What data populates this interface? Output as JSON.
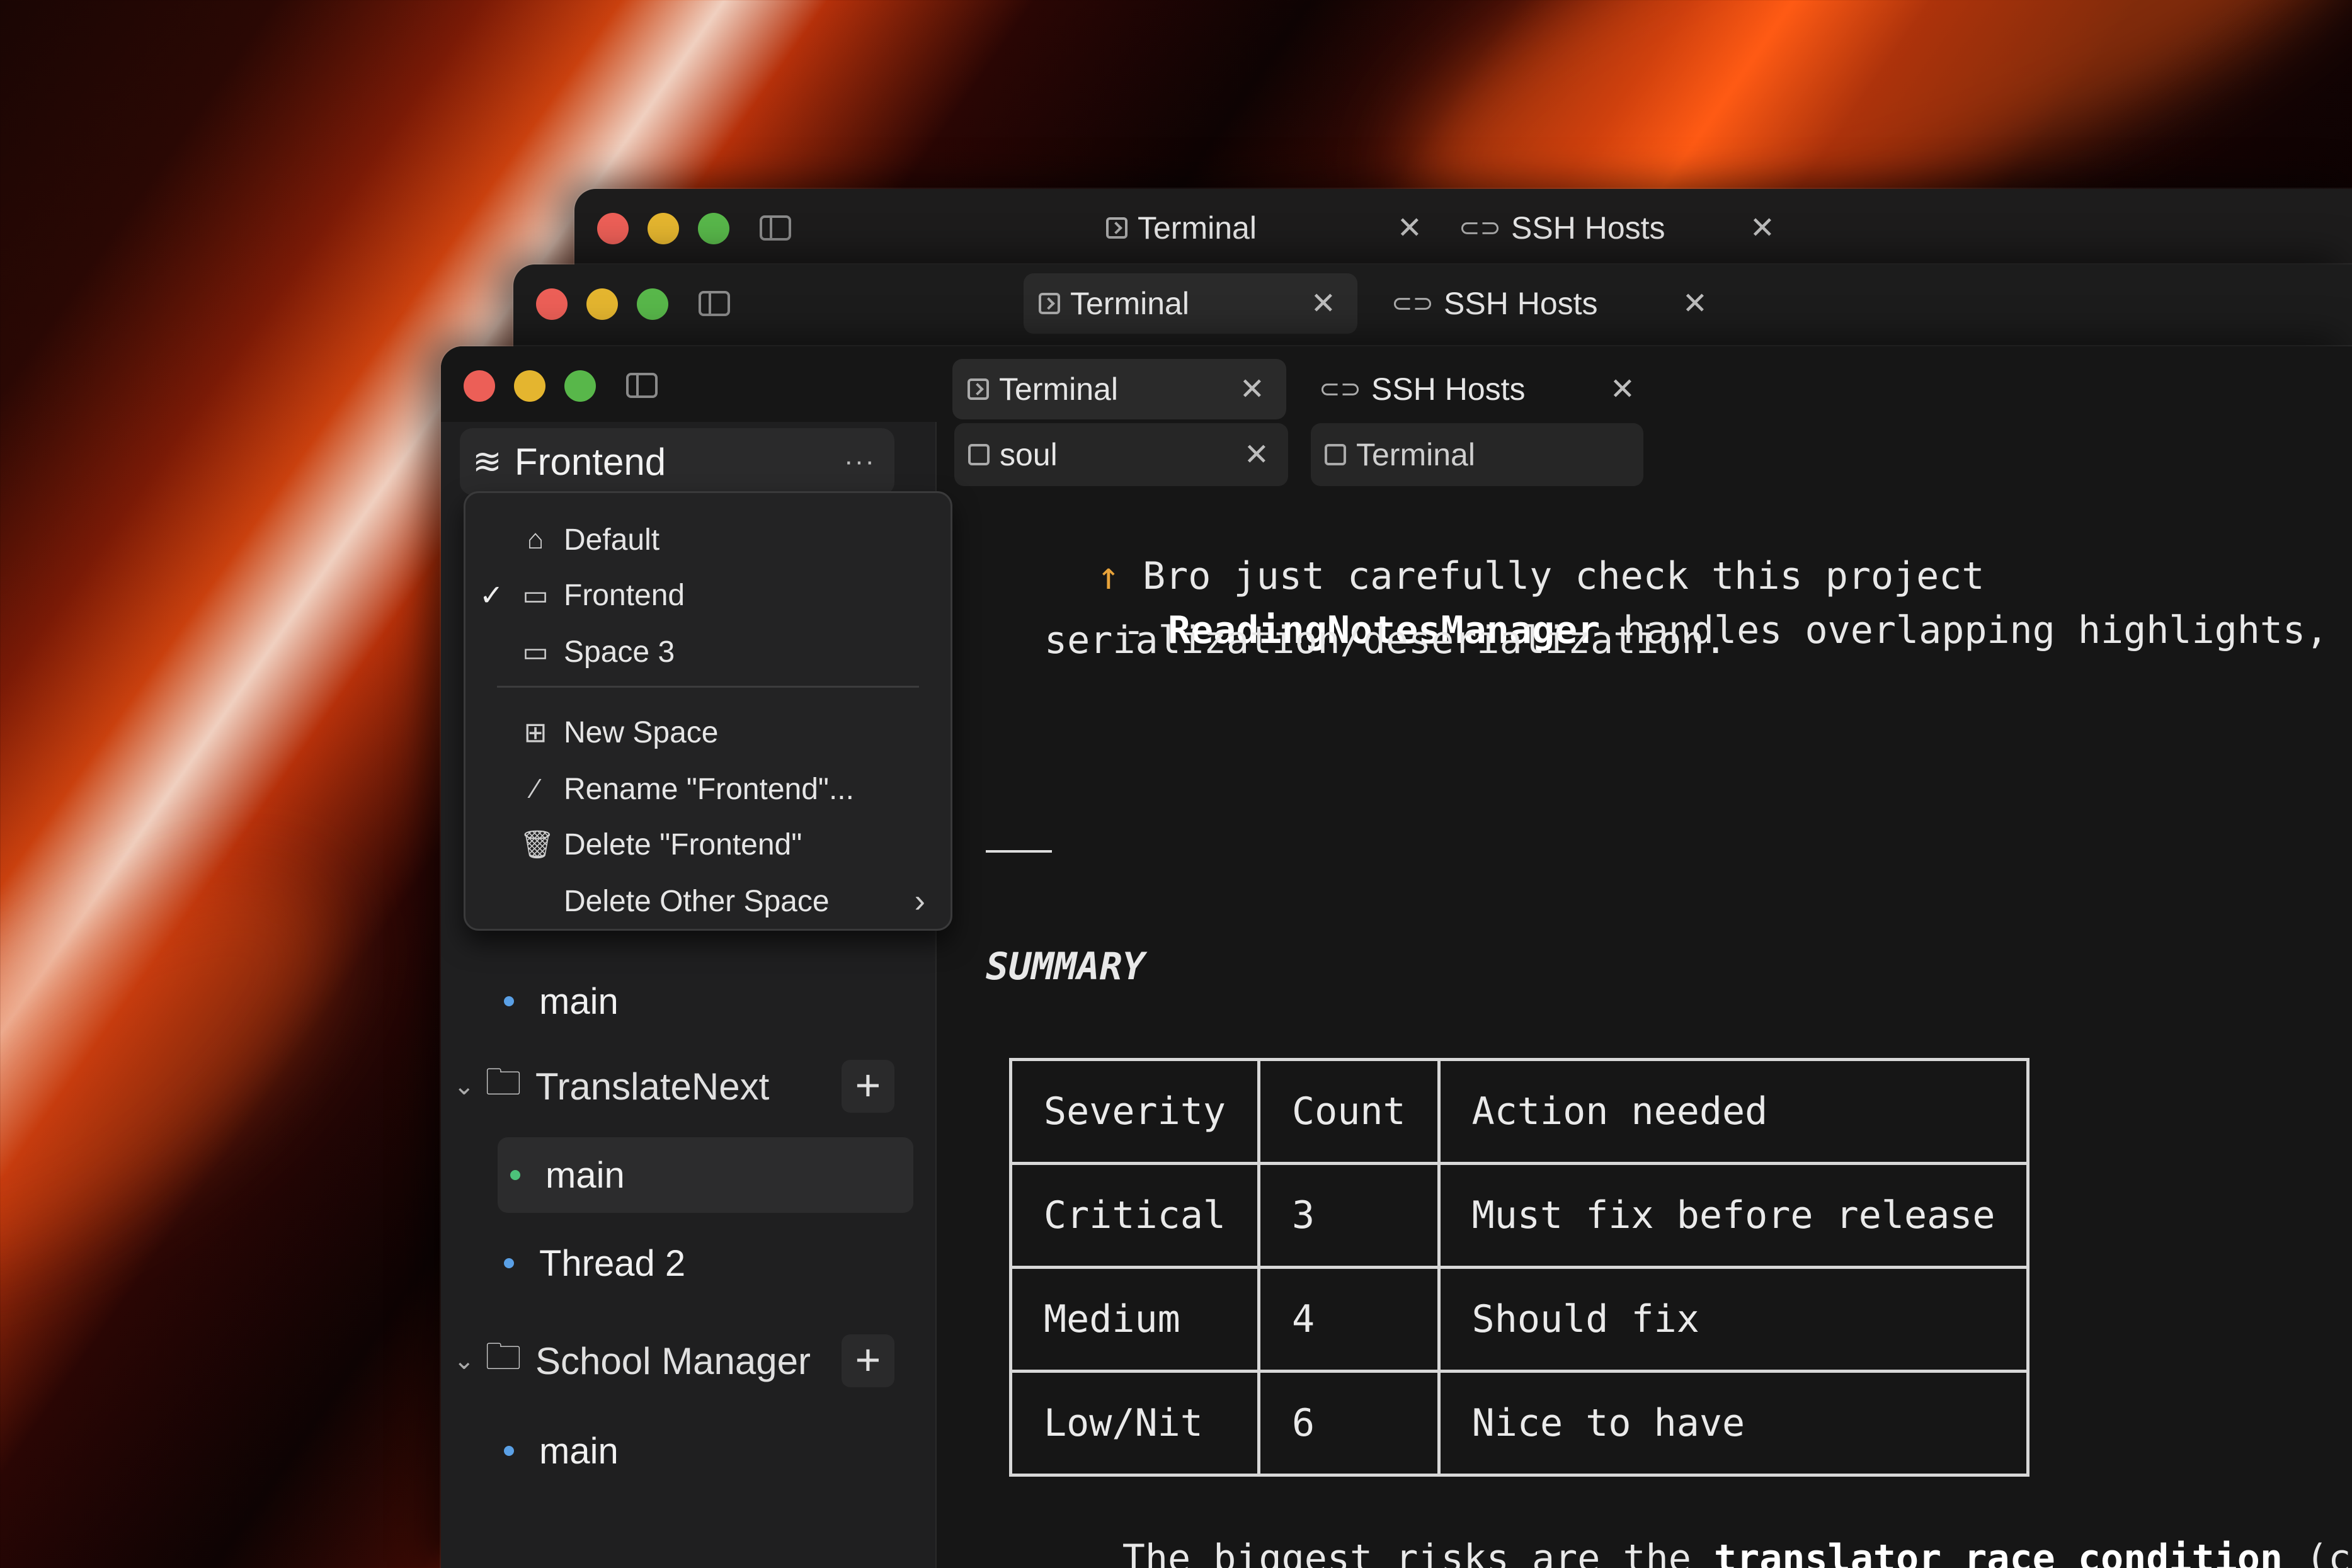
{
  "windows": {
    "back": {
      "tabs": [
        {
          "label": "Terminal",
          "icon": "terminal-icon"
        },
        {
          "label": "SSH Hosts",
          "icon": "link-icon"
        }
      ]
    },
    "middle": {
      "tabs": [
        {
          "label": "Terminal",
          "icon": "terminal-icon"
        },
        {
          "label": "SSH Hosts",
          "icon": "link-icon"
        }
      ]
    },
    "front": {
      "tabs": [
        {
          "label": "Terminal",
          "icon": "terminal-icon"
        },
        {
          "label": "SSH Hosts",
          "icon": "link-icon"
        }
      ],
      "subtabs": [
        {
          "label": "soul",
          "icon": "terminal-icon"
        },
        {
          "label": "Terminal",
          "icon": "terminal-icon"
        }
      ]
    }
  },
  "sidebar": {
    "space_title": "Frontend",
    "more": "···",
    "space_menu": {
      "items": [
        {
          "label": "Default",
          "icon": "home-icon",
          "checked": false
        },
        {
          "label": "Frontend",
          "icon": "space-icon",
          "checked": true
        },
        {
          "label": "Space 3",
          "icon": "space-icon",
          "checked": false
        }
      ],
      "actions": [
        {
          "label": "New Space",
          "icon": "plus-square-icon"
        },
        {
          "label": "Rename \"Frontend\"...",
          "icon": "pencil-icon"
        },
        {
          "label": "Delete \"Frontend\"",
          "icon": "trash-icon"
        },
        {
          "label": "Delete Other Space",
          "icon": "",
          "submenu": true
        }
      ]
    },
    "threads_top": [
      {
        "label": "main"
      }
    ],
    "folders": [
      {
        "name": "TranslateNext",
        "threads": [
          {
            "label": "main",
            "selected": true
          },
          {
            "label": "Thread 2",
            "selected": false
          }
        ]
      },
      {
        "name": "School Manager",
        "threads": [
          {
            "label": "main",
            "selected": false
          }
        ]
      }
    ]
  },
  "terminal": {
    "prompt_arrow": "↑",
    "prompt_text": "Bro just carefully check this project",
    "bullet_dash": "-",
    "bullet_bold": "ReadingNotesManager",
    "bullet_rest": " handles overlapping highlights, translat",
    "bullet_line2": "serialization/deserialization.",
    "heading": "SUMMARY",
    "table": {
      "headers": [
        "Severity",
        "Count",
        "Action needed"
      ],
      "rows": [
        [
          "Critical",
          "3",
          "Must fix before release"
        ],
        [
          "Medium",
          "4",
          "Should fix"
        ],
        [
          "Low/Nit",
          "6",
          "Nice to have"
        ]
      ]
    },
    "footer_prefix": "The biggest risks are the ",
    "footer_bold": "translator race condition",
    "footer_suffix": " (crash on"
  },
  "colors": {
    "accent_arrow": "#e8a33a",
    "traffic_red": "#ec5f57",
    "traffic_yellow": "#e4b52f",
    "traffic_green": "#58b74a",
    "bullet_blue": "#5aa0e6",
    "bullet_green": "#4cc27a"
  }
}
